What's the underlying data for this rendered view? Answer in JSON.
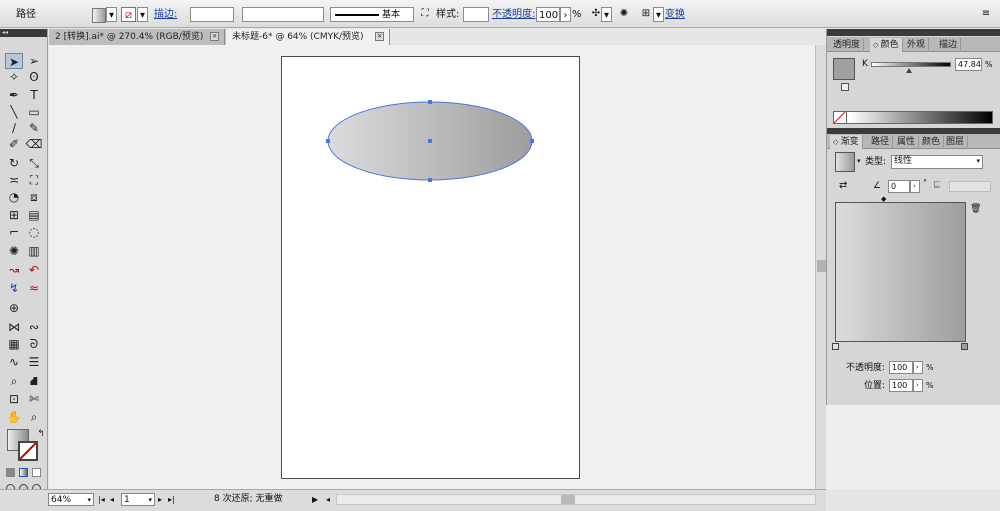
{
  "control_bar": {
    "object_type": "路径",
    "stroke_label": "描边:",
    "brush_label": "基本",
    "style_label": "样式:",
    "opacity_label": "不透明度:",
    "opacity_value": "100",
    "opacity_unit": "%",
    "transform_label": "变换"
  },
  "tabs": [
    {
      "label": "2 [转换].ai* @ 270.4% (RGB/预览)"
    },
    {
      "label": "未标题-6* @ 64% (CMYK/预览)"
    }
  ],
  "status_bar": {
    "zoom": "64%",
    "artboard": "1",
    "message": "8 次还原; 无重做"
  },
  "color_panel": {
    "tabs": [
      "透明度",
      "颜色",
      "外观",
      "描边"
    ],
    "active_tab": "颜色",
    "channel_label": "K",
    "channel_value": "47.84",
    "channel_unit": "%",
    "channel_fraction": 0.4784
  },
  "gradient_panel": {
    "tabs": [
      "渐变",
      "路径",
      "属性",
      "颜色",
      "图层"
    ],
    "active_tab": "渐变",
    "type_label": "类型:",
    "type_value": "线性",
    "angle_value": "0",
    "angle_unit": "°",
    "opacity_label": "不透明度:",
    "opacity_value": "100",
    "opacity_unit": "%",
    "location_label": "位置:",
    "location_value": "100",
    "location_unit": "%"
  },
  "colors": {
    "selection": "#4a78e0",
    "gradient_start": "#dcdcdc",
    "gradient_end": "#9d9d9d",
    "link": "#1b3f9b"
  },
  "icons": [
    "selection-tool-icon",
    "direct-selection-icon",
    "pen-icon",
    "type-icon",
    "eyedropper-icon",
    "zoom-icon",
    "hand-icon",
    "close-icon"
  ]
}
